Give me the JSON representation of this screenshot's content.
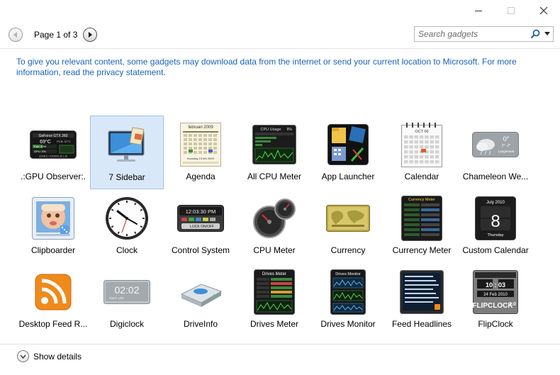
{
  "toolbar": {
    "page_indicator": "Page 1 of 3",
    "search_placeholder": "Search gadgets"
  },
  "privacy_notice": "To give you relevant content, some gadgets may download data from the internet or send your current location to Microsoft. For more information, read the privacy statement.",
  "gadgets": [
    {
      "label": ".:GPU Observer:.",
      "icon": "gpu-observer-icon"
    },
    {
      "label": "7 Sidebar",
      "icon": "sidebar-monitor-icon",
      "selected": true
    },
    {
      "label": "Agenda",
      "icon": "agenda-icon"
    },
    {
      "label": "All CPU Meter",
      "icon": "cpu-usage-icon"
    },
    {
      "label": "App Launcher",
      "icon": "app-launcher-icon"
    },
    {
      "label": "Calendar",
      "icon": "calendar-icon"
    },
    {
      "label": "Chameleon We...",
      "icon": "weather-cloud-icon"
    },
    {
      "label": "Clipboarder",
      "icon": "clipboarder-icon"
    },
    {
      "label": "Clock",
      "icon": "clock-icon"
    },
    {
      "label": "Control System",
      "icon": "control-system-icon"
    },
    {
      "label": "CPU Meter",
      "icon": "cpu-meter-gauge-icon"
    },
    {
      "label": "Currency",
      "icon": "currency-map-icon"
    },
    {
      "label": "Currency Meter",
      "icon": "currency-meter-icon"
    },
    {
      "label": "Custom Calendar",
      "icon": "custom-calendar-icon"
    },
    {
      "label": "Desktop Feed R...",
      "icon": "rss-feed-icon"
    },
    {
      "label": "Digiclock",
      "icon": "digital-clock-icon"
    },
    {
      "label": "DriveInfo",
      "icon": "hard-drive-icon"
    },
    {
      "label": "Drives Meter",
      "icon": "drives-meter-icon"
    },
    {
      "label": "Drives Monitor",
      "icon": "drives-monitor-icon"
    },
    {
      "label": "Feed Headlines",
      "icon": "feed-headlines-icon"
    },
    {
      "label": "FlipClock",
      "icon": "flip-clock-icon"
    }
  ],
  "thumb_text": {
    "gpu_model": "GeForce GTX 260",
    "gpu_temp": "69°C",
    "gpu_pcb": "PCB: 57°C",
    "gpu_fan": "Fan: 40%",
    "gpu_load": "GPU: 0%",
    "gpu_clock": "621MHz / 1053MHz @ 1.18",
    "agenda_month": "februari 2009",
    "agenda_day": "thursday 19 feb 2009",
    "cpu_usage_title": "CPU Usage",
    "cpu_usage_pct": "8%",
    "calendar_month": "OCT 06",
    "weather_temp": "0°",
    "weather_range": "2° -2°",
    "weather_city": "Langemark",
    "control_time": "12:03:30 PM",
    "control_lock": "LOCK ON/OFF",
    "currency_meter_title": "Currency Meter",
    "custom_cal_month": "July 2010",
    "custom_cal_day": "8",
    "custom_cal_weekday": "Thursday",
    "digiclock_time": "02:02",
    "digiclock_alarm": "Alarm Unit",
    "drives_meter_title": "Drives Meter",
    "drives_monitor_title": "Drives Monitor",
    "flip_hours": "10 : 03",
    "flip_date": "24 Feb 2010",
    "flip_brand": "FLIPCLOCK",
    "flip_version": "1.0"
  },
  "footer": {
    "show_details_label": "Show details"
  },
  "colors": {
    "link_blue": "#1a62b7",
    "selection_fill": "#d9e8f8",
    "selection_border": "#9fc2e6"
  }
}
